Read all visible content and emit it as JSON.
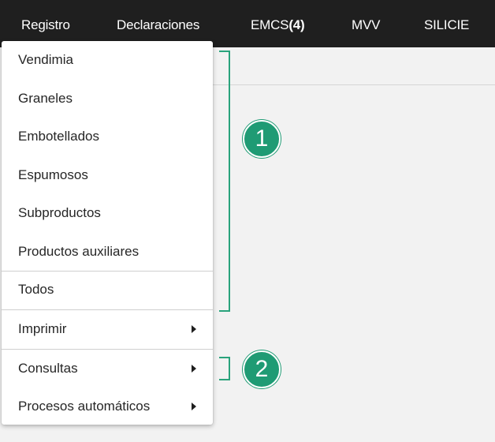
{
  "nav": {
    "registro": "Registro",
    "declaraciones": "Declaraciones",
    "emcs_label": "EMCS",
    "emcs_count": "(4)",
    "mvv": "MVV",
    "silicie": "SILICIE"
  },
  "menu": {
    "items": [
      {
        "label": "Vendimia"
      },
      {
        "label": "Graneles"
      },
      {
        "label": "Embotellados"
      },
      {
        "label": "Espumosos"
      },
      {
        "label": "Subproductos"
      },
      {
        "label": "Productos auxiliares"
      },
      {
        "label": "Todos"
      },
      {
        "label": "Imprimir"
      },
      {
        "label": "Consultas"
      },
      {
        "label": "Procesos automáticos"
      }
    ]
  },
  "annotations": {
    "badge_1": "1",
    "badge_2": "2",
    "accent_color": "#1f9b74"
  }
}
